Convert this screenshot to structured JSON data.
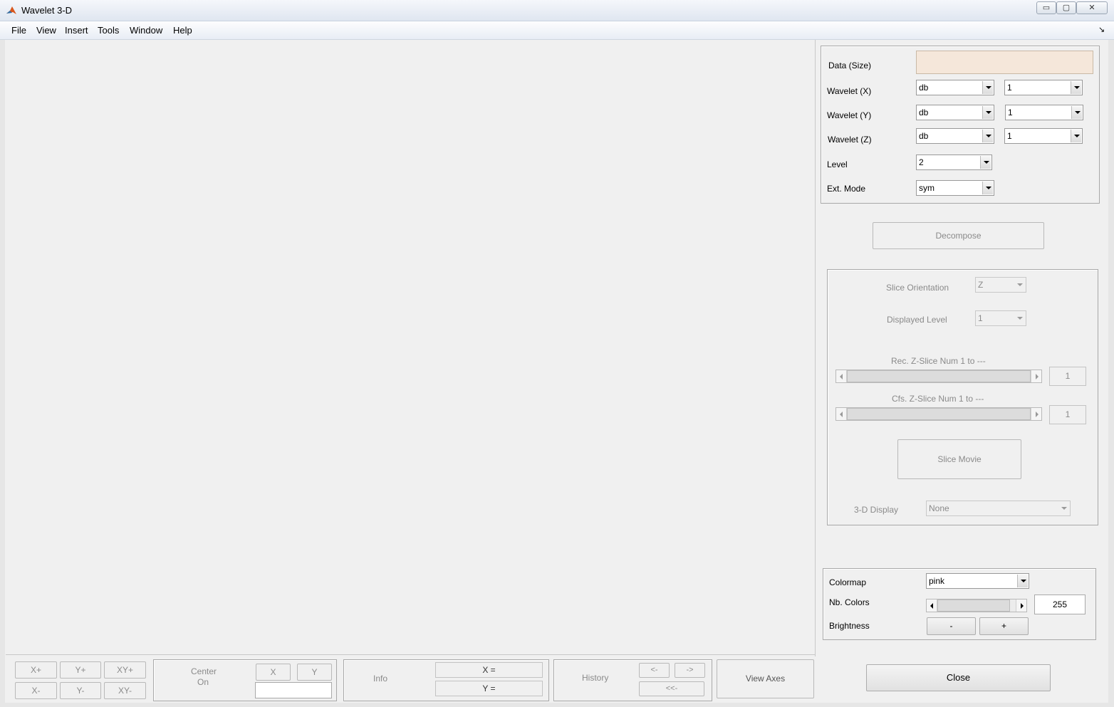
{
  "window": {
    "title": "Wavelet 3-D",
    "controls": {
      "minimize": "▭",
      "maximize": "▢",
      "close": "✕"
    }
  },
  "menubar": {
    "items": [
      "File",
      "View",
      "Insert",
      "Tools",
      "Window",
      "Help"
    ],
    "dock_arrow": "↘"
  },
  "params_panel": {
    "data_size_label": "Data  (Size)",
    "data_size_value": "",
    "wavelet_x_label": "Wavelet (X)",
    "wavelet_x_family": "db",
    "wavelet_x_number": "1",
    "wavelet_y_label": "Wavelet (Y)",
    "wavelet_y_family": "db",
    "wavelet_y_number": "1",
    "wavelet_z_label": "Wavelet (Z)",
    "wavelet_z_family": "db",
    "wavelet_z_number": "1",
    "level_label": "Level",
    "level_value": "2",
    "ext_mode_label": "Ext. Mode",
    "ext_mode_value": "sym"
  },
  "decompose_button": "Decompose",
  "slice_panel": {
    "orientation_label": "Slice Orientation",
    "orientation_value": "Z",
    "displayed_level_label": "Displayed Level",
    "displayed_level_value": "1",
    "rec_slice_label": "Rec. Z-Slice Num 1 to ---",
    "rec_slice_value": "1",
    "cfs_slice_label": "Cfs. Z-Slice Num 1 to ---",
    "cfs_slice_value": "1",
    "slice_movie_button": "Slice Movie",
    "display_3d_label": "3-D Display",
    "display_3d_value": "None"
  },
  "colormap_panel": {
    "colormap_label": "Colormap",
    "colormap_value": "pink",
    "nb_colors_label": "Nb. Colors",
    "nb_colors_value": "255",
    "brightness_label": "Brightness",
    "brightness_minus": "-",
    "brightness_plus": "+"
  },
  "close_button": "Close",
  "bottom_toolbar": {
    "xplus": "X+",
    "yplus": "Y+",
    "xyplus": "XY+",
    "xminus": "X-",
    "yminus": "Y-",
    "xyminus": "XY-",
    "center_on_line1": "Center",
    "center_on_line2": "On",
    "center_x": "X",
    "center_y": "Y",
    "center_value": "",
    "info_label": "Info",
    "info_x": "X =",
    "info_y": "Y =",
    "history_label": "History",
    "history_back": "<-",
    "history_forward": "->",
    "history_first": "<<-",
    "view_axes": "View Axes"
  },
  "colors": {
    "background": "#f0f0f0",
    "data_field": "#f5e7da",
    "disabled_text": "#8a8a8a",
    "matlab_icon": "#d9561c"
  }
}
